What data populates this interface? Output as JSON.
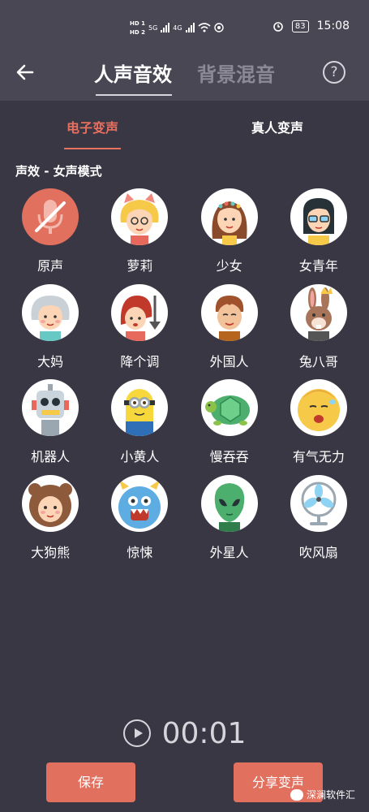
{
  "status_bar": {
    "hd1": "HD 1",
    "hd2": "HD 2",
    "net1": "5G",
    "net2": "4G",
    "battery": "83",
    "time": "15:08"
  },
  "header": {
    "active_tab": "人声音效",
    "inactive_tab": "背景混音",
    "help": "?"
  },
  "subtabs": [
    "电子变声",
    "真人变声"
  ],
  "section_title": "声效 - 女声模式",
  "effects": [
    {
      "label": "原声",
      "icon": "microphone-muted-icon"
    },
    {
      "label": "萝莉",
      "icon": "loli-girl-icon"
    },
    {
      "label": "少女",
      "icon": "young-girl-icon"
    },
    {
      "label": "女青年",
      "icon": "young-woman-glasses-icon"
    },
    {
      "label": "大妈",
      "icon": "old-lady-icon"
    },
    {
      "label": "降个调",
      "icon": "lower-pitch-icon"
    },
    {
      "label": "外国人",
      "icon": "foreigner-icon"
    },
    {
      "label": "兔八哥",
      "icon": "bunny-king-icon"
    },
    {
      "label": "机器人",
      "icon": "robot-icon"
    },
    {
      "label": "小黄人",
      "icon": "minion-icon"
    },
    {
      "label": "慢吞吞",
      "icon": "turtle-icon"
    },
    {
      "label": "有气无力",
      "icon": "yawning-face-icon"
    },
    {
      "label": "大狗熊",
      "icon": "bear-costume-icon"
    },
    {
      "label": "惊悚",
      "icon": "monster-icon"
    },
    {
      "label": "外星人",
      "icon": "alien-icon"
    },
    {
      "label": "吹风扇",
      "icon": "electric-fan-icon"
    }
  ],
  "player": {
    "time": "00:01"
  },
  "buttons": {
    "save": "保存",
    "share": "分享变声"
  },
  "watermark": "深澜软件汇",
  "colors": {
    "accent": "#e1705f",
    "background": "#3a3744",
    "header": "#4a4754"
  }
}
